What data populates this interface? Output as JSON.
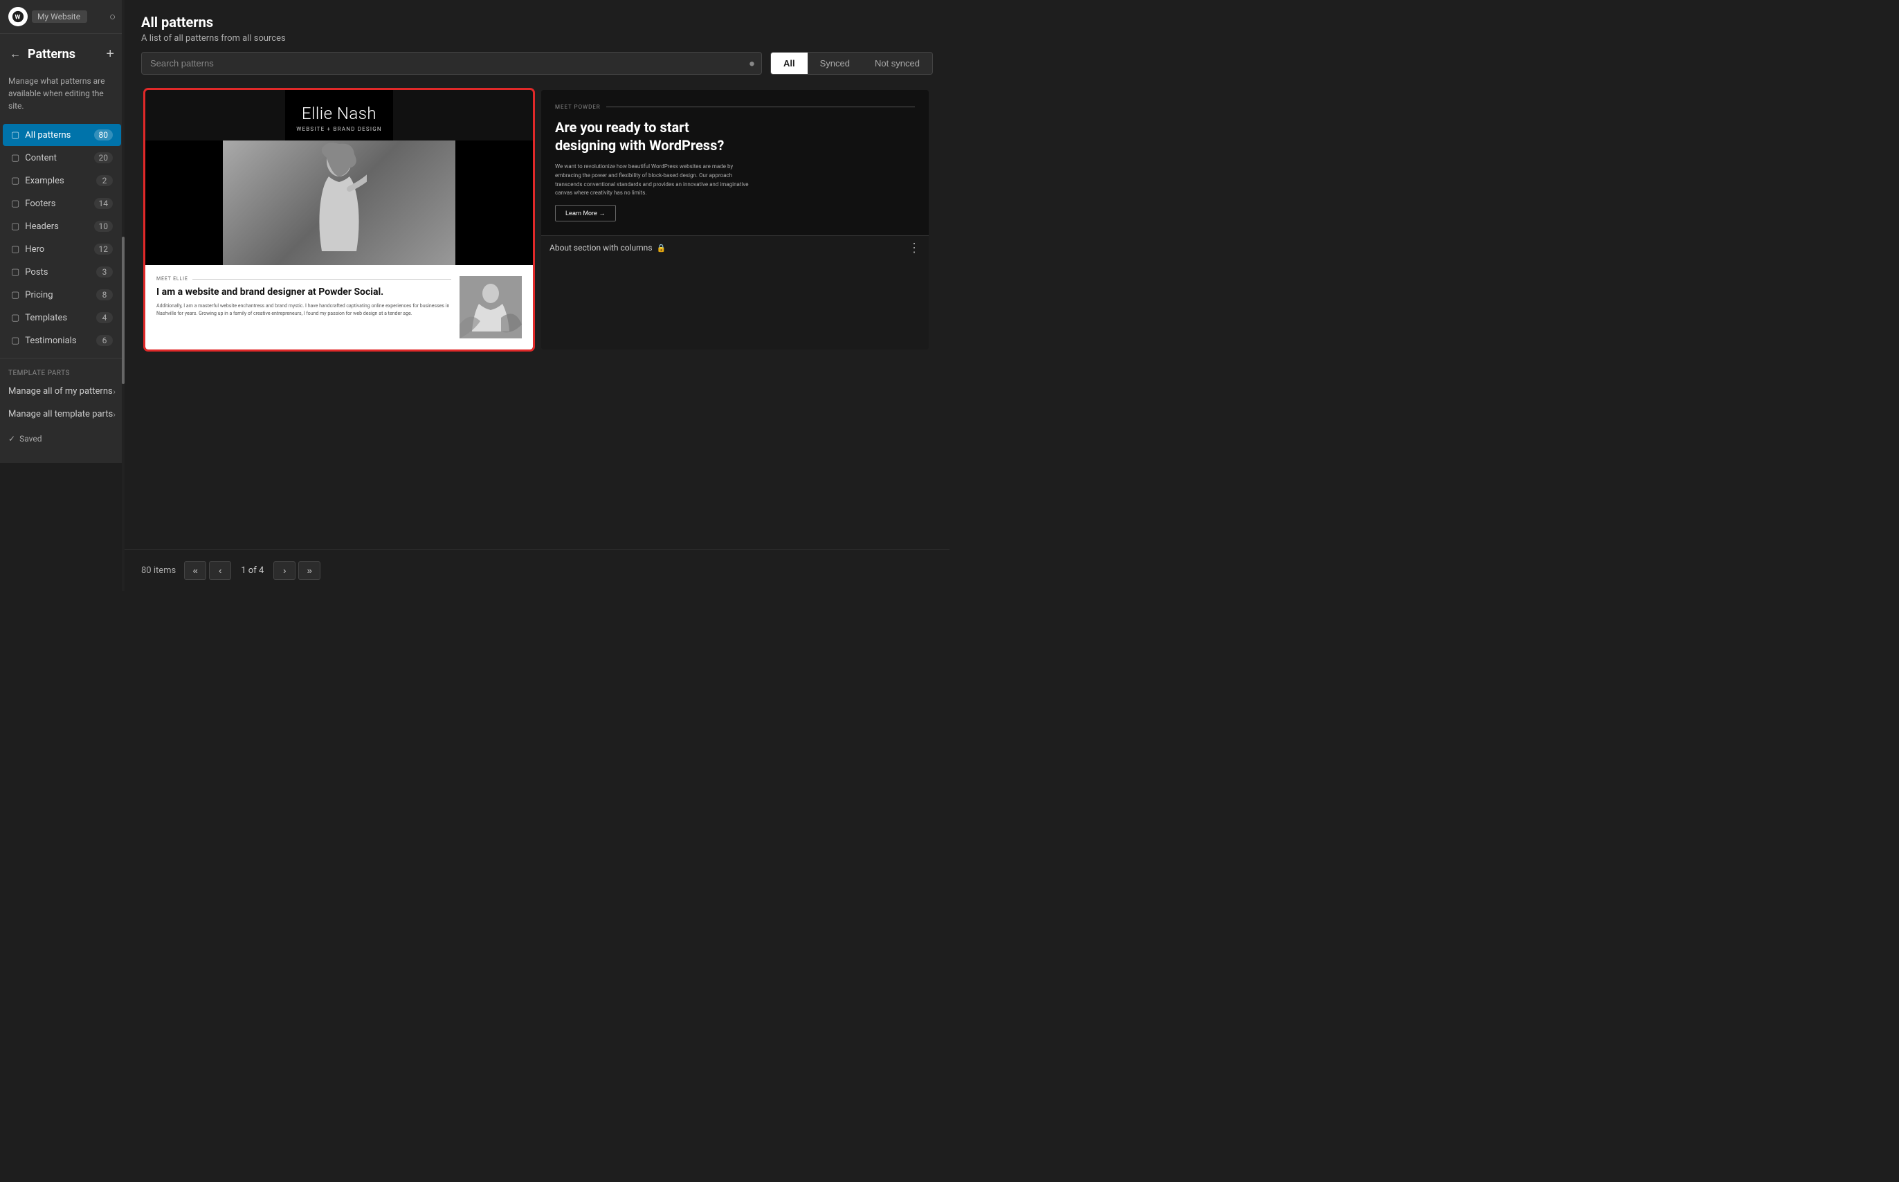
{
  "sidebar": {
    "title": "Patterns",
    "description": "Manage what patterns are available when editing the site.",
    "add_button_label": "+",
    "back_button_label": "←",
    "items": [
      {
        "id": "all-patterns",
        "label": "All patterns",
        "count": 80,
        "active": true
      },
      {
        "id": "content",
        "label": "Content",
        "count": 20,
        "active": false
      },
      {
        "id": "examples",
        "label": "Examples",
        "count": 2,
        "active": false
      },
      {
        "id": "footers",
        "label": "Footers",
        "count": 14,
        "active": false
      },
      {
        "id": "headers",
        "label": "Headers",
        "count": 10,
        "active": false
      },
      {
        "id": "hero",
        "label": "Hero",
        "count": 12,
        "active": false
      },
      {
        "id": "posts",
        "label": "Posts",
        "count": 3,
        "active": false
      },
      {
        "id": "pricing",
        "label": "Pricing",
        "count": 8,
        "active": false
      },
      {
        "id": "templates",
        "label": "Templates",
        "count": 4,
        "active": false
      },
      {
        "id": "testimonials",
        "label": "Testimonials",
        "count": 6,
        "active": false
      }
    ],
    "section_label": "TEMPLATE PARTS",
    "links": [
      {
        "id": "manage-patterns",
        "label": "Manage all of my patterns"
      },
      {
        "id": "manage-template-parts",
        "label": "Manage all template parts"
      }
    ],
    "footer_status": "Saved"
  },
  "header": {
    "title": "All patterns",
    "subtitle": "A list of all patterns from all sources"
  },
  "search": {
    "placeholder": "Search patterns"
  },
  "filter_tabs": [
    {
      "id": "all",
      "label": "All",
      "active": true
    },
    {
      "id": "synced",
      "label": "Synced",
      "active": false
    },
    {
      "id": "not-synced",
      "label": "Not synced",
      "active": false
    }
  ],
  "patterns": [
    {
      "id": "ellie-nash",
      "selected": true,
      "preview": {
        "type": "ellie-nash",
        "name": "Ellie Nash",
        "tagline": "WEBSITE + BRAND DESIGN",
        "section_label": "MEET ELLIE",
        "heading": "I am a website and brand designer at Powder Social.",
        "body": "Additionally, I am a masterful website enchantress and brand mystic. I have handcrafted captivating online experiences for businesses in Nashville for years. Growing up in a family of creative entrepreneurs, I found my passion for web design at a tender age."
      }
    },
    {
      "id": "about-section",
      "selected": false,
      "preview": {
        "type": "about-section",
        "section_label": "MEET POWDER",
        "heading": "Are you ready to start designing with WordPress?",
        "body": "We want to revolutionize how beautiful WordPress websites are made by embracing the power and flexibility of block-based design. Our approach transcends conventional standards and provides an innovative and imaginative canvas where creativity has no limits.",
        "learn_more": "Learn More →",
        "footer_label": "About section with columns",
        "locked": true
      }
    }
  ],
  "pagination": {
    "items_count": "80 items",
    "current_page": "1",
    "total_pages": "4",
    "page_text": "1 of 4",
    "first_label": "«",
    "prev_label": "‹",
    "next_label": "›",
    "last_label": "»"
  },
  "footer": {
    "status": "Saved",
    "checkmark": "✓"
  },
  "site_name": "My Website"
}
